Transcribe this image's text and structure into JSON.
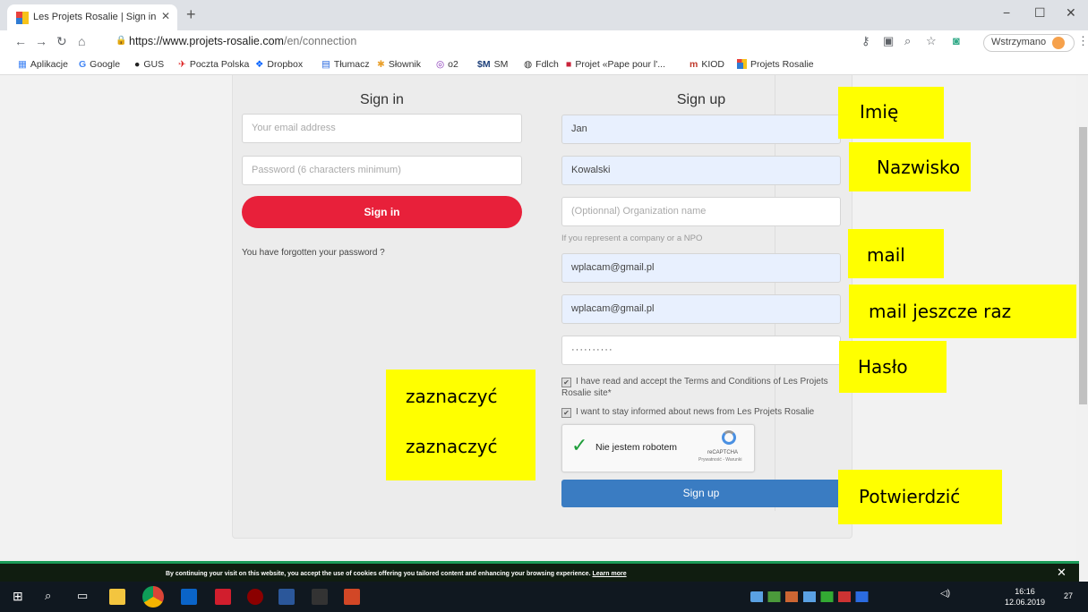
{
  "browser": {
    "tab_title": "Les Projets Rosalie | Sign in / sign",
    "tab_close": "✕",
    "new_tab": "+",
    "url_host": "https://www.projets-rosalie.com",
    "url_path": "/en/connection",
    "paused_label": "Wstrzymano",
    "window_controls": [
      "−",
      "☐",
      "✕"
    ]
  },
  "bookmarks": [
    {
      "label": "Aplikacje",
      "icon": "apps-icon"
    },
    {
      "label": "Google",
      "icon": "google-icon"
    },
    {
      "label": "GUS",
      "icon": "gus-icon"
    },
    {
      "label": "Poczta Polska",
      "icon": "poczta-icon"
    },
    {
      "label": "Dropbox",
      "icon": "dropbox-icon"
    },
    {
      "label": "Tłumacz",
      "icon": "translate-icon"
    },
    {
      "label": "Słownik",
      "icon": "dictionary-icon"
    },
    {
      "label": "o2",
      "icon": "o2-icon"
    },
    {
      "label": "SM",
      "icon": "sm-icon"
    },
    {
      "label": "Fdlch",
      "icon": "globe-icon"
    },
    {
      "label": "Projet «Pape pour l'...",
      "icon": "projet-icon"
    },
    {
      "label": "KIOD",
      "icon": "kiod-icon"
    },
    {
      "label": "Projets Rosalie",
      "icon": "rosalie-icon"
    }
  ],
  "signin": {
    "title": "Sign in",
    "email_placeholder": "Your email address",
    "password_placeholder": "Password (6 characters minimum)",
    "button": "Sign in",
    "forgot": "You have forgotten your password ?"
  },
  "signup": {
    "title": "Sign up",
    "first_name": "Jan",
    "last_name": "Kowalski",
    "org_placeholder": "(Optionnal) Organization name",
    "org_hint": "If you represent a company or a NPO",
    "email": "wplacam@gmail.pl",
    "email_confirm": "wplacam@gmail.pl",
    "password_mask": "··········",
    "terms_text": "I have read and accept the Terms and Conditions of Les Projets Rosalie site",
    "terms_star": "*",
    "news_text": "I want to stay informed about news from Les Projets Rosalie",
    "captcha_label": "Nie jestem robotem",
    "captcha_brand": "reCAPTCHA",
    "captcha_links": "Prywatność - Warunki",
    "button": "Sign up"
  },
  "annotations": {
    "imie": "Imię",
    "nazwisko": "Nazwisko",
    "mail": "mail",
    "mail_again": "mail jeszcze raz",
    "haslo": "Hasło",
    "zaznaczyc1": "zaznaczyć",
    "zaznaczyc2": "zaznaczyć",
    "potwierdzic": "Potwierdzić"
  },
  "cookie": {
    "text": "By continuing your visit on this website, you accept the use of cookies offering you tailored content and enhancing your browsing experience.",
    "link": "Learn more",
    "close": "✕"
  },
  "taskbar": {
    "time": "16:16",
    "date": "12.06.2019",
    "notif_count": "27"
  },
  "colors": {
    "signin_button": "#e8203a",
    "signup_button": "#3a7cc2",
    "annotation_bg": "#ffff00",
    "cookie_accent": "#1b9a57"
  }
}
